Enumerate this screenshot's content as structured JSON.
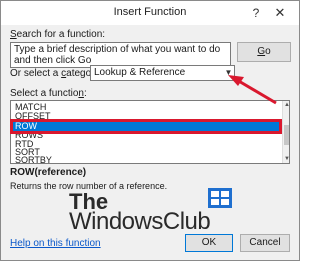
{
  "window": {
    "title": "Insert Function",
    "help_glyph": "?",
    "close_glyph": "✕"
  },
  "search": {
    "label_prefix": "",
    "label_hotkey": "S",
    "label_rest": "earch for a function:",
    "value": "Type a brief description of what you want to do and then click Go",
    "go_label_hotkey": "G",
    "go_label_rest": "o"
  },
  "category": {
    "label_prefix": "Or select a ",
    "label_hotkey": "c",
    "label_rest": "ategory:",
    "selected": "Lookup & Reference",
    "dropdown_glyph": "▼"
  },
  "function_list": {
    "label_prefix": "Select a functio",
    "label_hotkey": "n",
    "label_rest": ":",
    "items": [
      "MATCH",
      "OFFSET",
      "ROW",
      "ROWS",
      "RTD",
      "SORT",
      "SORTBY"
    ],
    "selected": "ROW"
  },
  "details": {
    "signature": "ROW(reference)",
    "description": "Returns the row number of a reference."
  },
  "watermark": {
    "line1": "The",
    "line2": "WindowsClub"
  },
  "footer": {
    "help_link": "Help on this function",
    "ok_label": "OK",
    "cancel_label": "Cancel"
  },
  "colors": {
    "annotation_red": "#d9182e",
    "selection_blue": "#0078d7",
    "link_blue": "#0a58ca"
  }
}
